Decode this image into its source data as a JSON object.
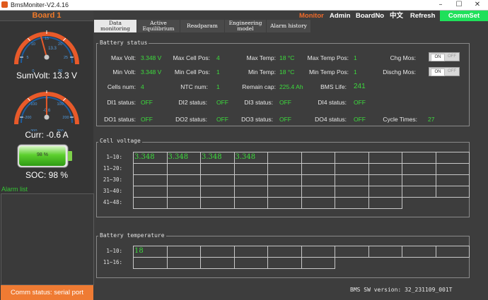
{
  "window": {
    "title": "BmsMoniter-V2.4.16",
    "minimize": "–",
    "maximize": "☐",
    "close": "✕"
  },
  "sidebar": {
    "board": "Board 1",
    "voltage_gauge": {
      "ticks": [
        "0",
        "5",
        "10",
        "15",
        "20",
        "25",
        "30"
      ],
      "readout": "13.3",
      "value": 13.3,
      "max": 30
    },
    "sumvolt": "SumVolt: 13.3 V",
    "current_gauge": {
      "ticks": [
        "-300",
        "-200",
        "-100",
        "0",
        "100",
        "200",
        "300"
      ],
      "readout": "-0.6",
      "value": -0.6,
      "min": -300,
      "max": 300
    },
    "curr": "Curr: -0.6 A",
    "battery_pct_label": "98 %",
    "battery_level": 0.98,
    "soc": "SOC: 98 %",
    "alarm_list": "Alarm list",
    "comm_status": "Comm status: serial port"
  },
  "menu": {
    "monitor": "Monitor",
    "admin": "Admin",
    "boardno": "BoardNo",
    "lang": "中文",
    "refresh": "Refresh",
    "commset": "CommSet"
  },
  "tabs": [
    {
      "line1": "Data",
      "line2": "monitoring"
    },
    {
      "line1": "Active",
      "line2": "Equilibrium"
    },
    {
      "line1": "Readparam",
      "line2": ""
    },
    {
      "line1": "Engineering",
      "line2": "model"
    },
    {
      "line1": "Alarm history",
      "line2": ""
    }
  ],
  "battery_status": {
    "title": "Battery status",
    "max_volt": {
      "label": "Max Volt:",
      "value": "3.348 V"
    },
    "min_volt": {
      "label": "Min Volt:",
      "value": "3.348 V"
    },
    "cells_num": {
      "label": "Cells num:",
      "value": "4"
    },
    "max_cell_pos": {
      "label": "Max Cell Pos:",
      "value": "4"
    },
    "min_cell_pos": {
      "label": "Min Cell Pos:",
      "value": "1"
    },
    "ntc_num": {
      "label": "NTC num:",
      "value": "1"
    },
    "max_temp": {
      "label": "Max Temp:",
      "value": "18 °C"
    },
    "min_temp": {
      "label": "Min Temp:",
      "value": "18 °C"
    },
    "remain_cap": {
      "label": "Remain cap:",
      "value": "225.4 Ah"
    },
    "max_temp_pos": {
      "label": "Max Temp Pos:",
      "value": "1"
    },
    "min_temp_pos": {
      "label": "Min Temp Pos:",
      "value": "1"
    },
    "bms_life": {
      "label": "BMS Life:",
      "value": "241"
    },
    "chg_mos": {
      "label": "Chg Mos:"
    },
    "dischg_mos": {
      "label": "Dischg Mos:"
    },
    "toggle_on": "ON",
    "toggle_off": "OFF",
    "di": [
      {
        "label": "DI1 status:",
        "value": "OFF"
      },
      {
        "label": "DI2 status:",
        "value": "OFF"
      },
      {
        "label": "DI3 status:",
        "value": "OFF"
      },
      {
        "label": "DI4 status:",
        "value": "OFF"
      }
    ],
    "do": [
      {
        "label": "DO1 status:",
        "value": "OFF"
      },
      {
        "label": "DO2 status:",
        "value": "OFF"
      },
      {
        "label": "DO3 status:",
        "value": "OFF"
      },
      {
        "label": "DO4 status:",
        "value": "OFF"
      }
    ],
    "cycle_times": {
      "label": "Cycle Times:",
      "value": "27"
    }
  },
  "cell_voltage": {
    "title": "Cell voltage",
    "rows": [
      "1~10:",
      "11~20:",
      "21~30:",
      "31~40:",
      "41~48:"
    ],
    "values": [
      "3.348",
      "3.348",
      "3.348",
      "3.348"
    ]
  },
  "battery_temperature": {
    "title": "Battery temperature",
    "rows": [
      "1~10:",
      "11~16:"
    ],
    "values": [
      "18"
    ]
  },
  "sw_version": "BMS SW version: 32_231109_001T",
  "colors": {
    "accent": "#f07a2a",
    "value_green": "#3ddc3d",
    "commset_green": "#1fe05a"
  }
}
